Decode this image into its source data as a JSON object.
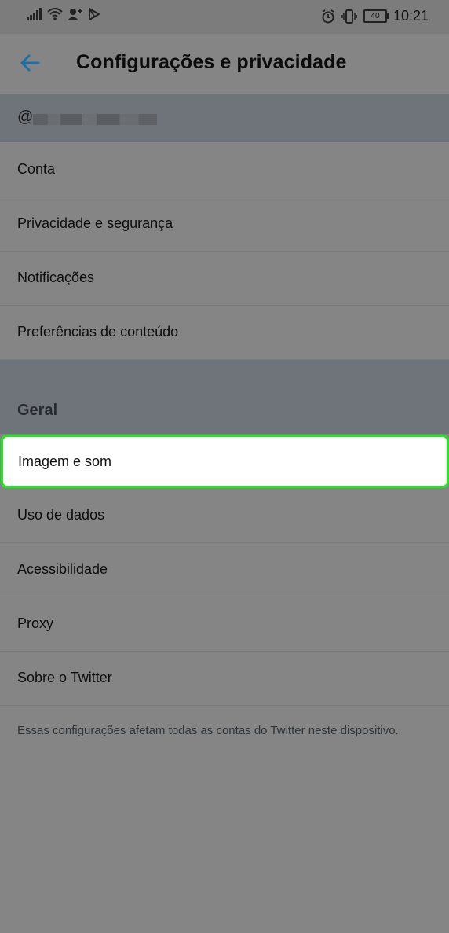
{
  "status_bar": {
    "time": "10:21",
    "battery": "40",
    "icons": [
      "signal-icon",
      "wifi-icon",
      "person-add-icon",
      "play-store-icon",
      "alarm-icon",
      "vibrate-icon",
      "battery-icon"
    ]
  },
  "header": {
    "title": "Configurações e privacidade",
    "back_icon": "arrow-left-icon"
  },
  "account": {
    "handle_prefix": "@"
  },
  "account_items": [
    {
      "label": "Conta"
    },
    {
      "label": "Privacidade e segurança"
    },
    {
      "label": "Notificações"
    },
    {
      "label": "Preferências de conteúdo"
    }
  ],
  "general_section": {
    "title": "Geral",
    "items": [
      {
        "label": "Imagem e som"
      },
      {
        "label": "Uso de dados"
      },
      {
        "label": "Acessibilidade"
      },
      {
        "label": "Proxy"
      },
      {
        "label": "Sobre o Twitter"
      }
    ]
  },
  "footer_note": "Essas configurações afetam todas as contas do Twitter neste dispositivo.",
  "colors": {
    "accent_blue": "#1d6fa8",
    "highlight_border": "#23e623",
    "overlay_bg": "#858585"
  }
}
